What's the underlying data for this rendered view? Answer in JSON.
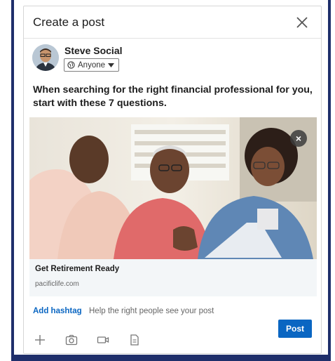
{
  "modal": {
    "title": "Create a post",
    "close_icon": "close-icon"
  },
  "author": {
    "name": "Steve Social",
    "visibility": "Anyone",
    "visibility_icon": "globe-icon",
    "dropdown_icon": "caret-down-icon"
  },
  "post": {
    "text": "When searching for the right financial professional for you, start with these 7 questions."
  },
  "link_preview": {
    "title": "Get Retirement Ready",
    "domain": "pacificlife.com",
    "remove_label": "×"
  },
  "hashtag": {
    "label": "Add hashtag",
    "hint": "Help the right people see your post"
  },
  "toolbar": {
    "icons": [
      "plus-icon",
      "camera-icon",
      "video-icon",
      "document-icon"
    ],
    "post_label": "Post"
  },
  "colors": {
    "frame": "#1f2f6b",
    "accent": "#0a66c2",
    "card_bg": "#f3f6f8"
  }
}
